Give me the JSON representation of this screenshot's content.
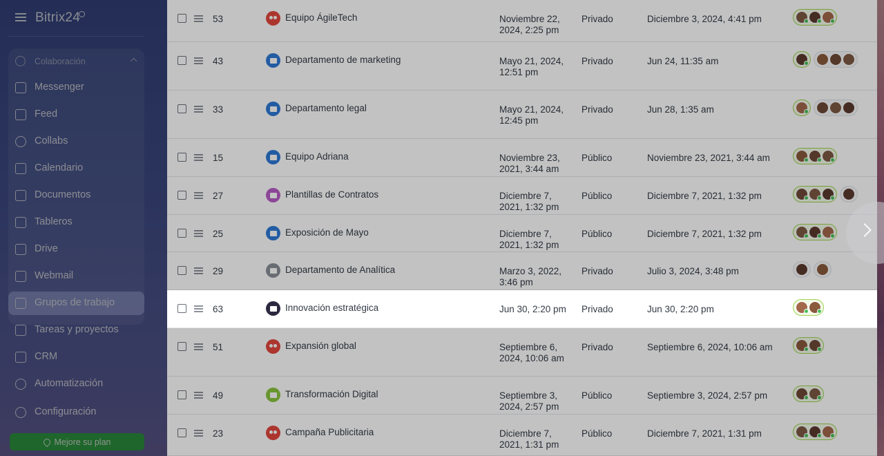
{
  "app": {
    "logo": "Bitrix24"
  },
  "sidebar": {
    "section": "Colaboración",
    "items": [
      {
        "label": "Messenger",
        "icon": "chat-icon"
      },
      {
        "label": "Feed",
        "icon": "feed-icon"
      },
      {
        "label": "Collabs",
        "icon": "collabs-icon"
      },
      {
        "label": "Calendario",
        "icon": "calendar-icon"
      },
      {
        "label": "Documentos",
        "icon": "document-icon"
      },
      {
        "label": "Tableros",
        "icon": "board-icon"
      },
      {
        "label": "Drive",
        "icon": "drive-icon"
      },
      {
        "label": "Webmail",
        "icon": "mail-icon"
      },
      {
        "label": "Grupos de trabajo",
        "icon": "group-icon",
        "active": true
      },
      {
        "label": "Tareas y proyectos",
        "icon": "tasks-icon"
      },
      {
        "label": "CRM",
        "icon": "crm-icon"
      },
      {
        "label": "Automatización",
        "icon": "automation-icon"
      },
      {
        "label": "Configuración",
        "icon": "settings-icon"
      }
    ],
    "upgrade_label": "Mejore su plan"
  },
  "table": {
    "rows": [
      {
        "id": "53",
        "name": "Equipo ÁgileTech",
        "icon": "team-icon",
        "icon_color": "#e2483d",
        "created": "Noviembre 22, 2024, 2:25 pm",
        "type": "Privado",
        "activity": "Diciembre 3, 2024, 4:41 pm",
        "members": 3,
        "extra": 0
      },
      {
        "id": "43",
        "name": "Departamento de marketing",
        "icon": "folder-icon",
        "icon_color": "#2f7ad6",
        "created": "Mayo 21, 2024, 12:51 pm",
        "type": "Privado",
        "activity": "Jun 24, 11:35 am",
        "members": 1,
        "extra": 3
      },
      {
        "id": "33",
        "name": "Departamento legal",
        "icon": "folder-icon",
        "icon_color": "#2f7ad6",
        "created": "Mayo 21, 2024, 12:45 pm",
        "type": "Privado",
        "activity": "Jun 28, 1:35 am",
        "members": 1,
        "extra": 3
      },
      {
        "id": "15",
        "name": "Equipo Adriana",
        "icon": "folder-icon",
        "icon_color": "#2f7ad6",
        "created": "Noviembre 23, 2021, 3:44 am",
        "type": "Público",
        "activity": "Noviembre 23, 2021, 3:44 am",
        "members": 3,
        "extra": 0
      },
      {
        "id": "27",
        "name": "Plantillas de Contratos",
        "icon": "briefcase-icon",
        "icon_color": "#b85cc7",
        "created": "Diciembre 7, 2021, 1:32 pm",
        "type": "Público",
        "activity": "Diciembre 7, 2021, 1:32 pm",
        "members": 3,
        "extra": 1
      },
      {
        "id": "25",
        "name": "Exposición de Mayo",
        "icon": "folder-icon",
        "icon_color": "#2f7ad6",
        "created": "Diciembre 7, 2021, 1:32 pm",
        "type": "Público",
        "activity": "Diciembre 7, 2021, 1:32 pm",
        "members": 3,
        "extra": 0
      },
      {
        "id": "29",
        "name": "Departamento de Analítica",
        "icon": "printer-icon",
        "icon_color": "#8a9097",
        "created": "Marzo 3, 2022, 3:46 pm",
        "type": "Privado",
        "activity": "Julio 3, 2024, 3:48 pm",
        "members": 1,
        "extra": 1,
        "plain": true
      },
      {
        "id": "63",
        "name": "Innovación estratégica",
        "icon": "innovation-icon",
        "icon_color": "#2b2840",
        "created": "Jun 30, 2:20 pm",
        "type": "Privado",
        "activity": "Jun 30, 2:20 pm",
        "members": 2,
        "extra": 0,
        "highlight": true
      },
      {
        "id": "51",
        "name": "Expansión global",
        "icon": "team-icon",
        "icon_color": "#e2483d",
        "created": "Septiembre 6, 2024, 10:06 am",
        "type": "Privado",
        "activity": "Septiembre 6, 2024, 10:06 am",
        "members": 2,
        "extra": 0
      },
      {
        "id": "49",
        "name": "Transformación Digital",
        "icon": "chat-bubble-icon",
        "icon_color": "#8ac43f",
        "created": "Septiembre 3, 2024, 2:57 pm",
        "type": "Público",
        "activity": "Septiembre 3, 2024, 2:57 pm",
        "members": 2,
        "extra": 0
      },
      {
        "id": "23",
        "name": "Campaña Publicitaria",
        "icon": "team-icon",
        "icon_color": "#e2483d",
        "created": "Diciembre 7, 2021, 1:31 pm",
        "type": "Público",
        "activity": "Diciembre 7, 2021, 1:31 pm",
        "members": 3,
        "extra": 0
      }
    ]
  },
  "pager": {
    "next_icon": "chevron-right-icon"
  }
}
